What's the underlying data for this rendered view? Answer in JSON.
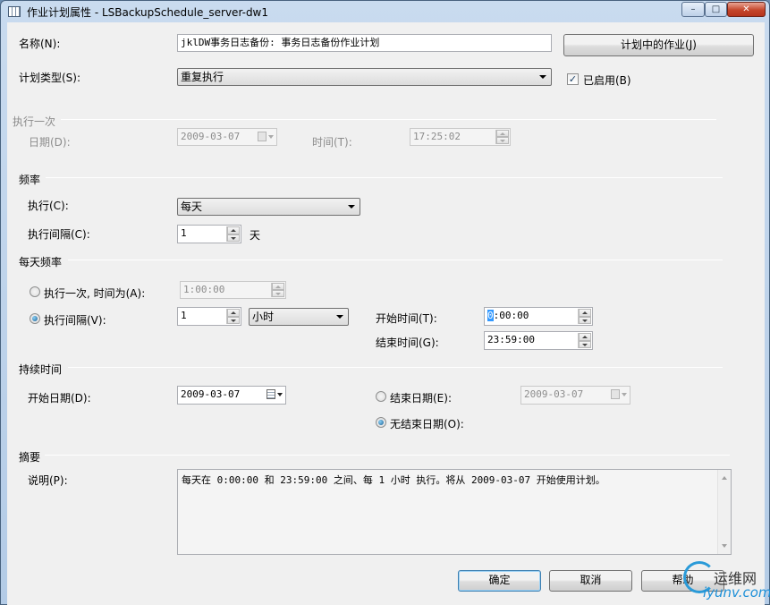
{
  "window": {
    "title": "作业计划属性 - LSBackupSchedule_server-dw1",
    "minimize": "–",
    "maximize": "□",
    "close": "✕"
  },
  "general": {
    "name_label": "名称(N):",
    "name_value": "jklDW事务日志备份: 事务日志备份作业计划",
    "jobs_button": "计划中的作业(J)",
    "type_label": "计划类型(S):",
    "type_value": "重复执行",
    "enabled_label": "已启用(B)",
    "enabled_mark": "✓"
  },
  "one_time": {
    "section": "执行一次",
    "date_label": "日期(D):",
    "date_value": "2009-03-07",
    "time_label": "时间(T):",
    "time_value": "17:25:02"
  },
  "frequency": {
    "section": "频率",
    "occurs_label": "执行(C):",
    "occurs_value": "每天",
    "recurs_label": "执行间隔(C):",
    "recurs_value": "1",
    "recurs_unit": "天"
  },
  "daily": {
    "section": "每天频率",
    "once_label": "执行一次, 时间为(A):",
    "once_value": "1:00:00",
    "every_label": "执行间隔(V):",
    "every_value": "1",
    "every_unit": "小时",
    "start_label": "开始时间(T):",
    "start_caret": "0",
    "start_value": ":00:00",
    "end_label": "结束时间(G):",
    "end_value": "23:59:00"
  },
  "duration": {
    "section": "持续时间",
    "start_label": "开始日期(D):",
    "start_value": "2009-03-07",
    "end_label": "结束日期(E):",
    "end_value": "2009-03-07",
    "no_end_label": "无结束日期(O):"
  },
  "summary": {
    "section": "摘要",
    "desc_label": "说明(P):",
    "desc_value": "每天在 0:00:00 和 23:59:00 之间、每 1 小时 执行。将从 2009-03-07 开始使用计划。"
  },
  "buttons": {
    "ok": "确定",
    "cancel": "取消",
    "help": "帮助"
  },
  "watermark": {
    "brand": "运维网",
    "url": "iyunv.com"
  }
}
